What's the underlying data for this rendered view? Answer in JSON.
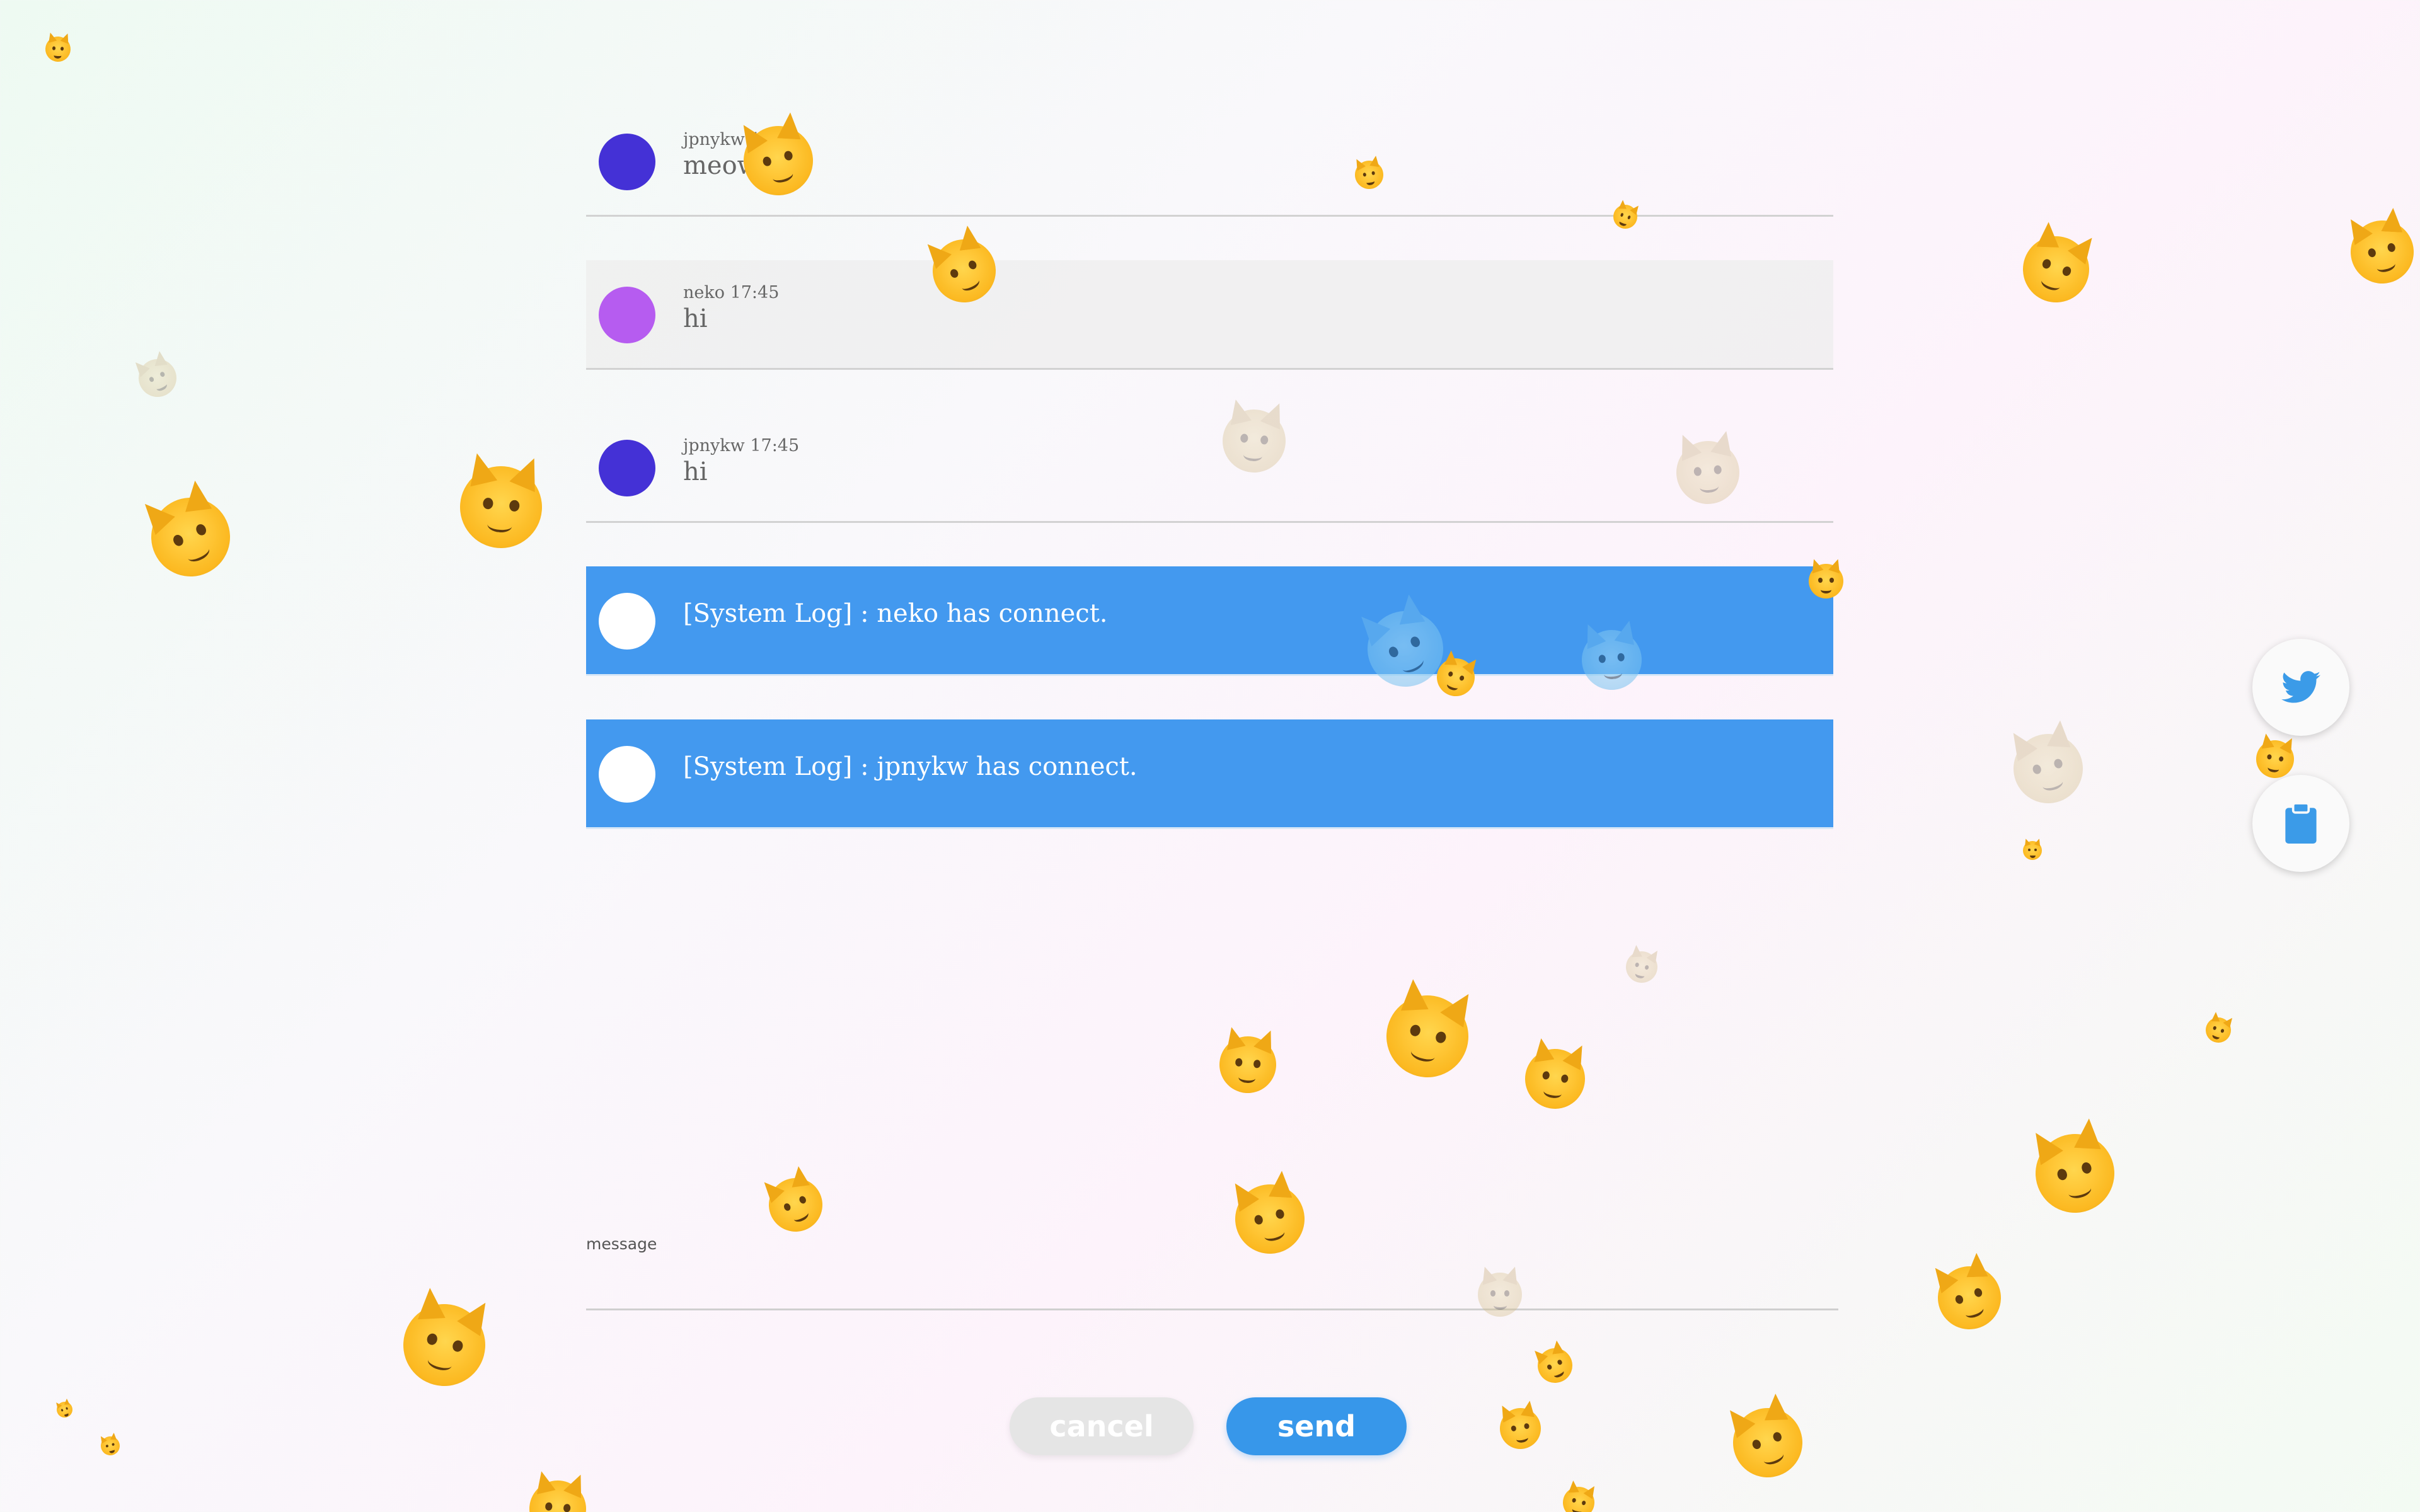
{
  "messages": [
    {
      "user": "jpnykw",
      "time": "17:45",
      "meta": "jpnykw 17:45",
      "text": "meow",
      "avatar_color": "#4431d6",
      "type": "user",
      "shaded": false
    },
    {
      "user": "neko",
      "time": "17:45",
      "meta": "neko 17:45",
      "text": "hi",
      "avatar_color": "#b65cf0",
      "type": "user",
      "shaded": true
    },
    {
      "user": "jpnykw",
      "time": "17:45",
      "meta": "jpnykw 17:45",
      "text": "hi",
      "avatar_color": "#4431d6",
      "type": "user",
      "shaded": false
    },
    {
      "text": "[System Log] : neko has connect.",
      "avatar_color": "#ffffff",
      "type": "system"
    },
    {
      "text": "[System Log] : jpnykw has connect.",
      "avatar_color": "#ffffff",
      "type": "system"
    }
  ],
  "composer": {
    "label": "message",
    "value": "",
    "placeholder": ""
  },
  "buttons": {
    "cancel_label": "cancel",
    "send_label": "send"
  },
  "side_actions": {
    "twitter_icon": "twitter-icon",
    "clipboard_icon": "clipboard-icon"
  },
  "colors": {
    "system_bg": "#4399ef",
    "send_bg": "#3797ea",
    "cancel_bg": "#e5e5e5",
    "icon_blue": "#3b9be8"
  },
  "decorations": {
    "emoji_icon": "cat-emoji-icon"
  }
}
